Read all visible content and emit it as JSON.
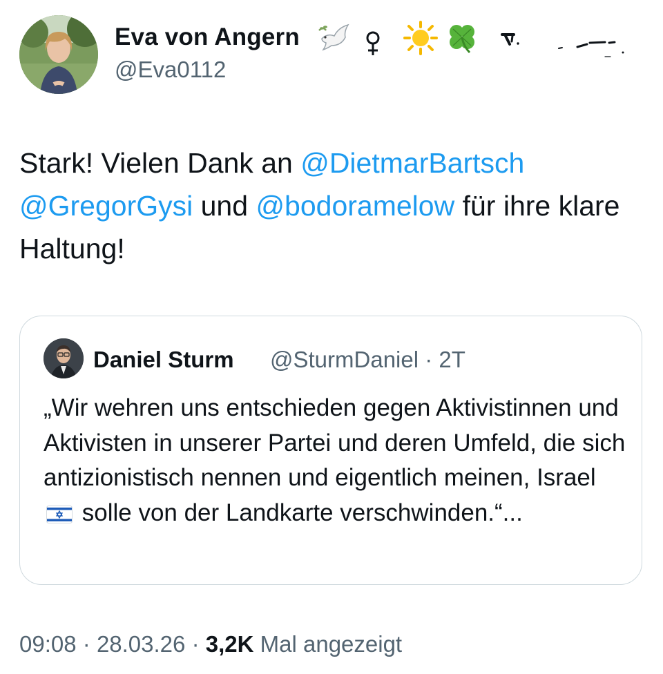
{
  "author": {
    "display_name": "Eva von Angern",
    "handle": "@Eva0112",
    "name_emojis": [
      "dove-icon",
      "female-sign-icon",
      "sun-icon",
      "four-leaf-clover-icon"
    ]
  },
  "tweet": {
    "text_parts": [
      {
        "text": "Stark! Vielen Dank an ",
        "type": "text"
      },
      {
        "text": "@DietmarBartsch",
        "type": "mention"
      },
      {
        "text": " ",
        "type": "text"
      },
      {
        "text": "@GregorGysi",
        "type": "mention"
      },
      {
        "text": " und ",
        "type": "text"
      },
      {
        "text": "@bodoramelow",
        "type": "mention"
      },
      {
        "text": " für ihre klare Haltung!",
        "type": "text"
      }
    ]
  },
  "quote": {
    "display_name": "Daniel Sturm",
    "handle_time": "@SturmDaniel · 2T",
    "text_before_flag": "„Wir wehren uns entschieden gegen Aktivistinnen und Aktivisten in unserer Partei und deren Umfeld, die sich antizionistisch nennen und eigentlich meinen, Israel",
    "flag": "israel-flag-icon",
    "text_after_flag": "solle von der Landkarte verschwinden.“..."
  },
  "meta": {
    "time": "09:08",
    "date": "28.03.26",
    "separator": "·",
    "views_count": "3,2K",
    "views_label": "Mal angezeigt"
  },
  "colors": {
    "mention": "#1d9bf0",
    "secondary_text": "#536471",
    "border": "#cfd9de"
  }
}
